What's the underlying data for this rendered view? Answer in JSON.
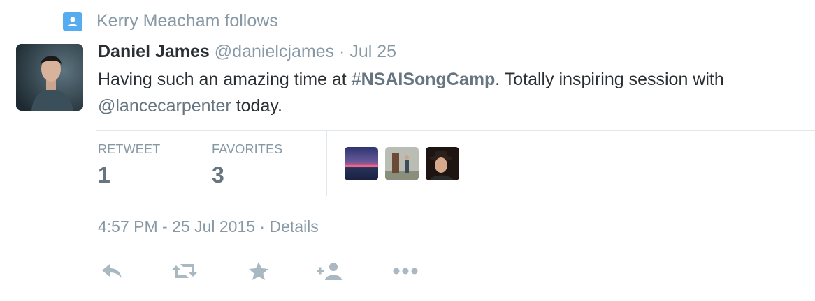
{
  "context": {
    "icon": "person-icon",
    "text": "Kerry Meacham follows"
  },
  "tweet": {
    "author_name": "Daniel James",
    "screen_name": "@danielcjames",
    "separator": "·",
    "time": "Jul 25",
    "text_parts": {
      "before": "Having such an amazing time at ",
      "hashtag_symbol": "#",
      "hashtag": "NSAISongCamp",
      "middle": ". Totally inspiring session with",
      "mention": "@lancecarpenter",
      "after": " today."
    }
  },
  "stats": {
    "retweet_label": "RETWEET",
    "retweet_count": "1",
    "favorites_label": "FAVORITES",
    "favorites_count": "3"
  },
  "meta": {
    "timestamp": "4:57 PM - 25 Jul 2015",
    "separator": "·",
    "details_link": "Details"
  },
  "actions": [
    "reply-icon",
    "retweet-icon",
    "favorite-icon",
    "follow-icon",
    "more-icon"
  ],
  "colors": {
    "accent": "#55acee",
    "muted": "#8899a6",
    "text": "#292f33",
    "divider": "#e1e8ed"
  }
}
